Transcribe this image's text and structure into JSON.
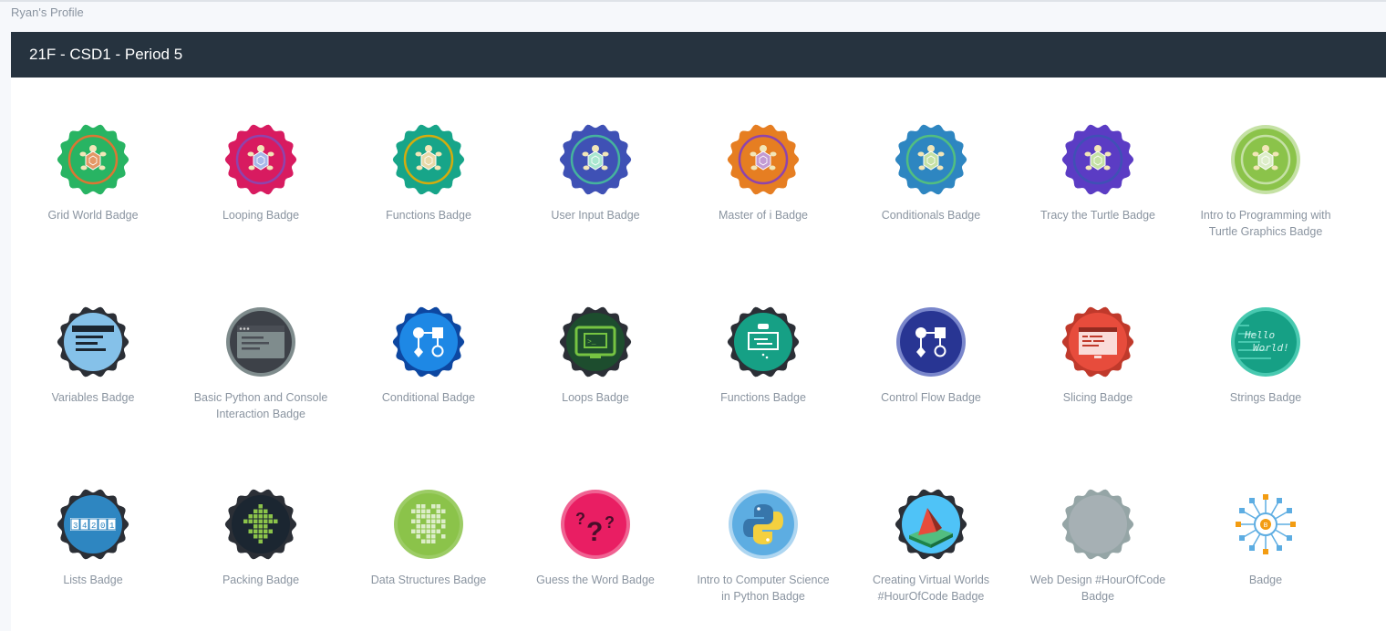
{
  "breadcrumb": "Ryan's Profile",
  "section": {
    "title": "21F - CSD1 - Period 5"
  },
  "badges": [
    {
      "label": "Grid World Badge",
      "icon": "turtle-icon",
      "style": "scallop",
      "c1": "#28b463",
      "c2": "#dc7633",
      "c3": "#e59866"
    },
    {
      "label": "Looping Badge",
      "icon": "turtle-icon",
      "style": "scallop",
      "c1": "#d81b60",
      "c2": "#8e44ad",
      "c3": "#a7b8e8"
    },
    {
      "label": "Functions Badge",
      "icon": "turtle-icon",
      "style": "scallop",
      "c1": "#17a589",
      "c2": "#d4ac0d",
      "c3": "#e8d9a8"
    },
    {
      "label": "User Input Badge",
      "icon": "turtle-icon",
      "style": "scallop",
      "c1": "#3f51b5",
      "c2": "#45b39d",
      "c3": "#a8e6cf"
    },
    {
      "label": "Master of i Badge",
      "icon": "turtle-icon",
      "style": "scallop",
      "c1": "#e67e22",
      "c2": "#8e44ad",
      "c3": "#c39bd3"
    },
    {
      "label": "Conditionals Badge",
      "icon": "turtle-icon",
      "style": "scallop",
      "c1": "#2e86c1",
      "c2": "#52be80",
      "c3": "#c5e1a5"
    },
    {
      "label": "Tracy the Turtle Badge",
      "icon": "turtle-icon",
      "style": "scallop",
      "c1": "#5b3cc4",
      "c2": "#3f51b5",
      "c3": "#c5e1a5"
    },
    {
      "label": "Intro to Programming with Turtle Graphics Badge",
      "icon": "turtle-icon",
      "style": "circle",
      "c1": "#8bc34a",
      "c2": "#c5e1a5",
      "c3": "#dcedc8"
    },
    {
      "label": "Variables Badge",
      "icon": "window-icon",
      "style": "scallop",
      "c1": "#2b2f36",
      "c2": "#85c1e9",
      "c3": "#1b2631"
    },
    {
      "label": "Basic Python and Console Interaction Badge",
      "icon": "terminal-window-icon",
      "style": "circle",
      "c1": "#3d4148",
      "c2": "#7f8c8d",
      "c3": "#2c2f33"
    },
    {
      "label": "Conditional Badge",
      "icon": "flowchart-icon",
      "style": "scallop",
      "c1": "#0d47a1",
      "c2": "#1e88e5",
      "c3": "#ffffff"
    },
    {
      "label": "Loops Badge",
      "icon": "monitor-icon",
      "style": "scallop",
      "c1": "#2b2f36",
      "c2": "#1d4d2e",
      "c3": "#76c442"
    },
    {
      "label": "Functions Badge",
      "icon": "function-flow-icon",
      "style": "scallop",
      "c1": "#2b2f36",
      "c2": "#16a085",
      "c3": "#ffffff"
    },
    {
      "label": "Control Flow Badge",
      "icon": "flowchart-icon",
      "style": "circle",
      "c1": "#2c3e9e",
      "c2": "#283593",
      "c3": "#ffffff"
    },
    {
      "label": "Slicing Badge",
      "icon": "code-window-icon",
      "style": "scallop",
      "c1": "#c0392b",
      "c2": "#e74c3c",
      "c3": "#fadbd8"
    },
    {
      "label": "Strings Badge",
      "icon": "hello-world-icon",
      "style": "circle",
      "c1": "#16a085",
      "c2": "#48c9b0",
      "c3": "#d1f2eb",
      "text1": "Hello",
      "text2": "World!"
    },
    {
      "label": "Lists Badge",
      "icon": "list-boxes-icon",
      "style": "scallop",
      "c1": "#2b2f36",
      "c2": "#2e86c1",
      "c3": "#ffffff",
      "digits": "34201"
    },
    {
      "label": "Packing Badge",
      "icon": "pixel-tree-icon",
      "style": "scallop",
      "c1": "#2b2f36",
      "c2": "#1b2631",
      "c3": "#8bc34a"
    },
    {
      "label": "Data Structures Badge",
      "icon": "pixel-grid-icon",
      "style": "circle",
      "c1": "#8bc34a",
      "c2": "#9ccc65",
      "c3": "#dcedc8"
    },
    {
      "label": "Guess the Word Badge",
      "icon": "question-marks-icon",
      "style": "circle",
      "c1": "#e91e63",
      "c2": "#f06292",
      "c3": "#4a0e2a"
    },
    {
      "label": "Intro to Computer Science in Python Badge",
      "icon": "python-logo-icon",
      "style": "circle",
      "c1": "#5dade2",
      "c2": "#aed6f1",
      "c3": "#f4d03f"
    },
    {
      "label": "Creating Virtual Worlds #HourOfCode Badge",
      "icon": "tent-world-icon",
      "style": "scallop",
      "c1": "#2b2f36",
      "c2": "#4fc3f7",
      "c3": "#e74c3c"
    },
    {
      "label": "Web Design #HourOfCode Badge",
      "icon": "blank-icon",
      "style": "scallop",
      "c1": "#95a5a6",
      "c2": "#a6b0b4",
      "c3": "#a6b0b4"
    },
    {
      "label": "Badge",
      "icon": "network-hub-icon",
      "style": "none",
      "c1": "#5dade2",
      "c2": "#f39c12",
      "c3": "#ffffff"
    }
  ]
}
